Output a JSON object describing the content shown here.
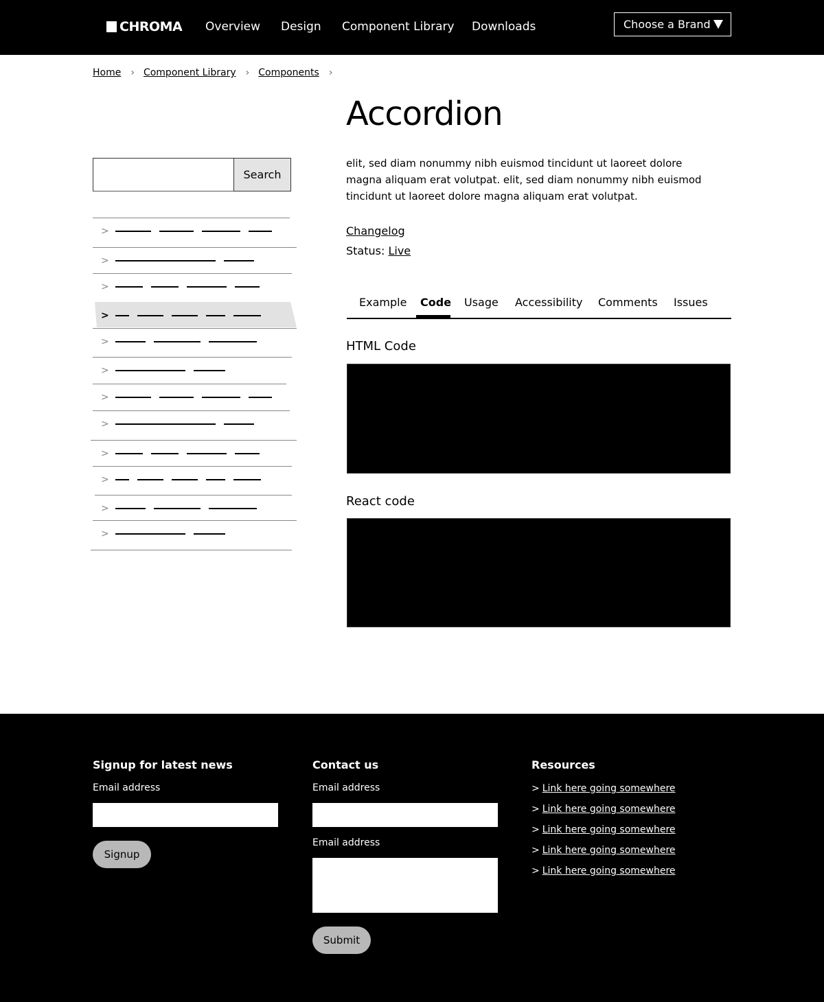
{
  "header": {
    "logo_text": "CHROMA",
    "nav": [
      "Overview",
      "Design",
      "Component Library",
      "Downloads"
    ],
    "brand_select": "Choose a Brand"
  },
  "breadcrumb": [
    "Home",
    "Component Library",
    "Components"
  ],
  "sidebar": {
    "search_placeholder": "",
    "search_button": "Search",
    "active_index": 3
  },
  "main": {
    "title": "Accordion",
    "intro": "elit, sed diam nonummy nibh euismod tincidunt ut laoreet dolore magna aliquam erat volutpat. elit, sed diam nonummy nibh euismod tincidunt ut laoreet dolore magna aliquam erat volutpat.",
    "changelog": "Changelog",
    "status_label": "Status:",
    "status_value": "Live",
    "tabs": [
      "Example",
      "Code",
      "Usage",
      "Accessibility",
      "Comments",
      "Issues"
    ],
    "active_tab": "Code",
    "html_code_label": "HTML Code",
    "react_code_label": "React code"
  },
  "footer": {
    "signup": {
      "heading": "Signup for latest news",
      "email_label": "Email address",
      "button": "Signup"
    },
    "contact": {
      "heading": "Contact us",
      "email_label": "Email address",
      "message_label": "Email address",
      "button": "Submit"
    },
    "resources": {
      "heading": "Resources",
      "links": [
        "Link here going somewhere",
        "Link here going somewhere",
        "Link here going somewhere",
        "Link here going somewhere",
        "Link here going somewhere"
      ]
    }
  },
  "colors": {
    "header_bg": "#000000",
    "footer_bg": "#000000",
    "active_item_bg": "#e2e2e2",
    "button_gray": "#b8b8b8"
  }
}
